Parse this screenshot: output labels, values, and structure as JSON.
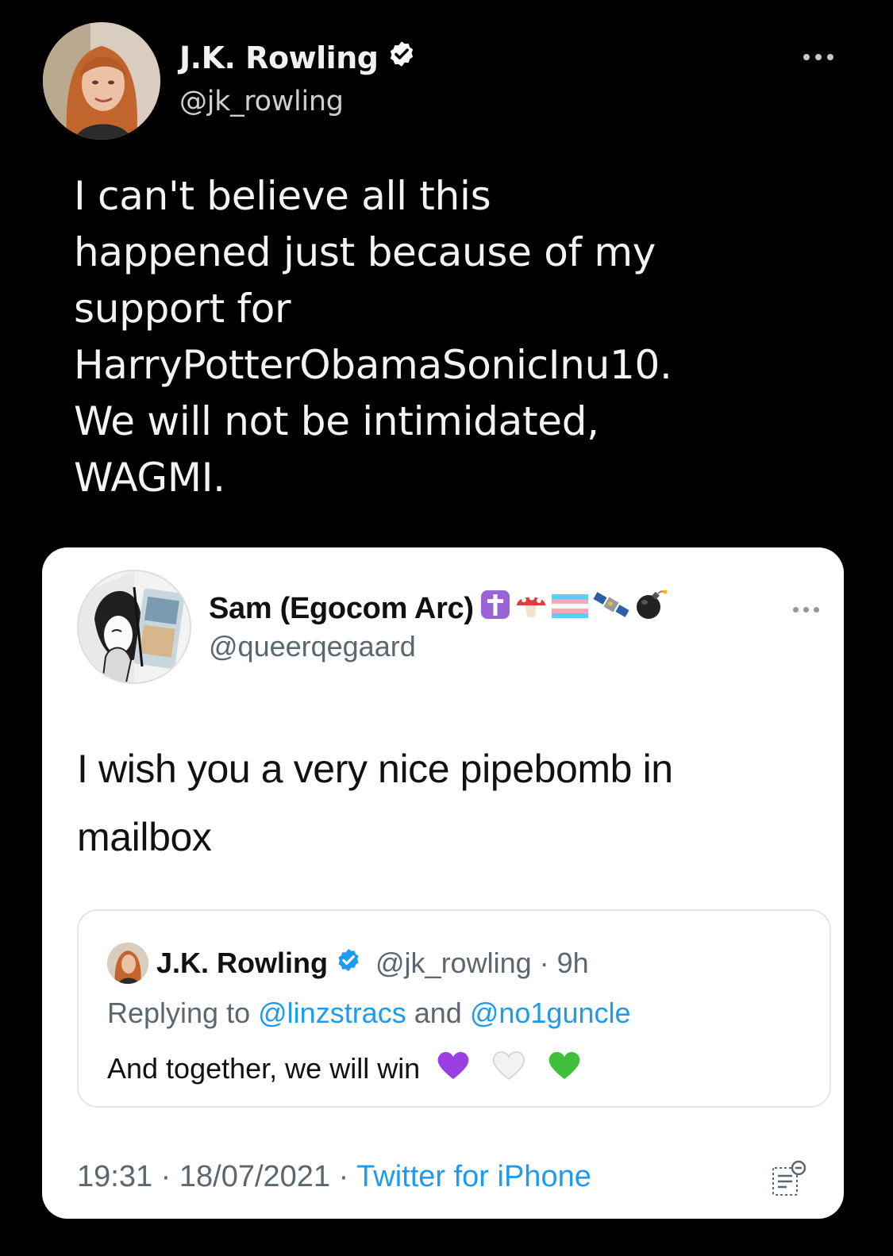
{
  "outer_tweet": {
    "author_name": "J.K. Rowling",
    "author_handle": "@jk_rowling",
    "verified_icon": "verified-badge-icon",
    "more_icon": "more-options-icon",
    "text_lines": [
      "I can't believe all this",
      "happened just because of my",
      "support for",
      "HarryPotterObamaSonicInu10.",
      "We will not be intimidated,",
      "WAGMI."
    ]
  },
  "quoted_screenshot": {
    "author_name": "Sam (Egocom Arc)",
    "name_emojis": [
      "latin-cross-icon",
      "mushroom-icon",
      "transgender-flag-icon",
      "satellite-icon",
      "bomb-icon"
    ],
    "author_handle": "@queerqegaard",
    "text": "I wish you a very nice pipebomb in mailbox",
    "embedded_tweet": {
      "author_name": "J.K. Rowling",
      "author_handle": "@jk_rowling",
      "time_ago": "9h",
      "separator": "·",
      "replying_prefix": "Replying to",
      "reply_user_1": "@linzstracs",
      "reply_joiner": "and",
      "reply_user_2": "@no1guncle",
      "text": "And together, we will win",
      "hearts": [
        "purple-heart-icon",
        "white-heart-icon",
        "green-heart-icon"
      ]
    },
    "footer": {
      "time": "19:31",
      "date": "18/07/2021",
      "separator": "·",
      "source": "Twitter for iPhone"
    },
    "colors": {
      "link": "#1d9bf0",
      "muted": "#5b6670",
      "verified": "#1d9bf0"
    }
  }
}
